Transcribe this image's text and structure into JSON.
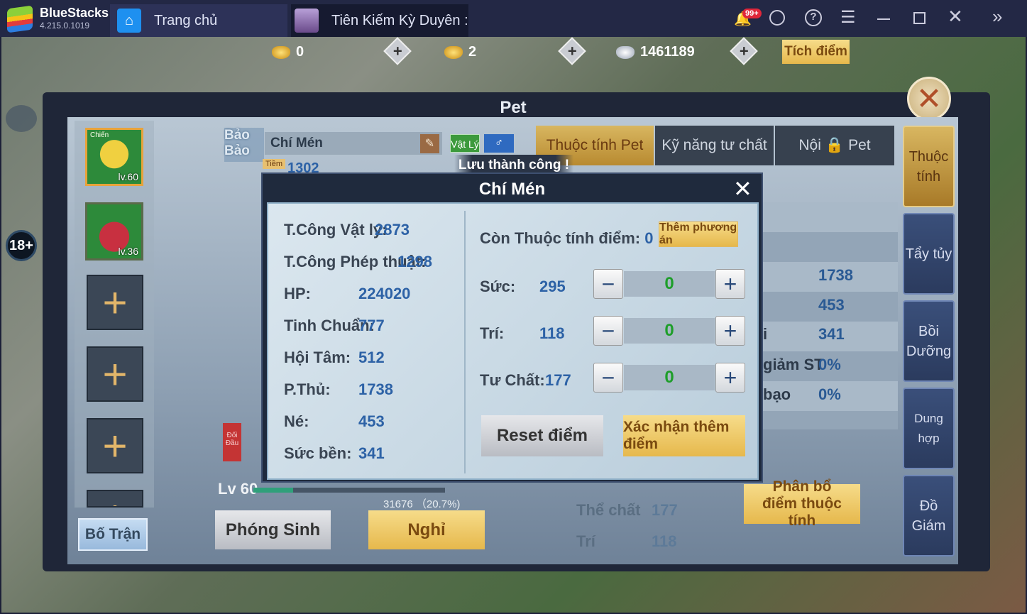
{
  "app": {
    "name": "BlueStacks",
    "version": "4.215.0.1019",
    "tabs": [
      {
        "label": "Trang chủ"
      },
      {
        "label": "Tiên Kiếm Kỳ Duyên :"
      }
    ],
    "notif_badge": "99+"
  },
  "currency": {
    "gold": "0",
    "locked_gold": "2",
    "silver": "1461189",
    "points_button": "Tích điểm"
  },
  "panel": {
    "title": "Pet",
    "pet_name": "Chí Mén",
    "name_badge": "Bảo Bảo",
    "type_tag": "Vật Lý",
    "potential_label": "Tiềm",
    "potential_value": "1302",
    "toast": "Lưu thành công !",
    "level": "Lv 60",
    "exp": "31676 （20.7%)",
    "exp_fraction": 0.207,
    "release_button": "Phóng Sinh",
    "rest_button": "Nghỉ",
    "formation_button": "Bố Trận",
    "battle_tag": "Đối Đầu",
    "pets": [
      {
        "level": "lv.60",
        "tag": "Chiến"
      },
      {
        "level": "lv.36"
      }
    ],
    "tabs": [
      {
        "label": "Thuộc tính Pet"
      },
      {
        "label": "Kỹ năng tư chất"
      },
      {
        "label": "Nội"
      },
      {
        "label": "Pet"
      }
    ],
    "side_tabs": [
      {
        "label": "Thuộc tính"
      },
      {
        "label": "Tẩy tủy"
      },
      {
        "label": "Bồi Dưỡng"
      },
      {
        "label": "Dung hợp"
      },
      {
        "label": "Đồ Giám"
      }
    ],
    "bg_rows": [
      {
        "label": "",
        "value": "1738"
      },
      {
        "label": "",
        "value": "453"
      },
      {
        "label": "i",
        "value": "341"
      },
      {
        "label": "giảm ST",
        "value": "0%"
      },
      {
        "label": "bạo",
        "value": "0%"
      }
    ],
    "bottom_rows": [
      {
        "label": "Thể chất",
        "value": "177"
      },
      {
        "label": "Trí",
        "value": "118"
      }
    ],
    "allocate_button": "Phân bổ điểm thuộc tính"
  },
  "dialog": {
    "title": "Chí Mén",
    "stats": [
      {
        "label": "T.Công Vật lý:",
        "value": "2873"
      },
      {
        "label": "T.Công Phép thuật:",
        "value": "1298"
      },
      {
        "label": "HP:",
        "value": "224020"
      },
      {
        "label": "Tinh Chuẩn:",
        "value": "777"
      },
      {
        "label": "Hội Tâm:",
        "value": "512"
      },
      {
        "label": "P.Thủ:",
        "value": "1738"
      },
      {
        "label": "Né:",
        "value": "453"
      },
      {
        "label": "Sức bền:",
        "value": "341"
      }
    ],
    "remaining_label": "Còn Thuộc tính điểm:",
    "remaining_value": "0",
    "add_plan_button": "Thêm phương án",
    "attrs": [
      {
        "label": "Sức:",
        "value": "295",
        "input": "0"
      },
      {
        "label": "Trí:",
        "value": "118",
        "input": "0"
      },
      {
        "label": "Tư Chất:",
        "value": "177",
        "input": "0"
      }
    ],
    "minus": "−",
    "plus": "+",
    "reset_button": "Reset điểm",
    "confirm_button": "Xác nhận thêm điểm"
  },
  "side": {
    "age_badge": "18+"
  }
}
